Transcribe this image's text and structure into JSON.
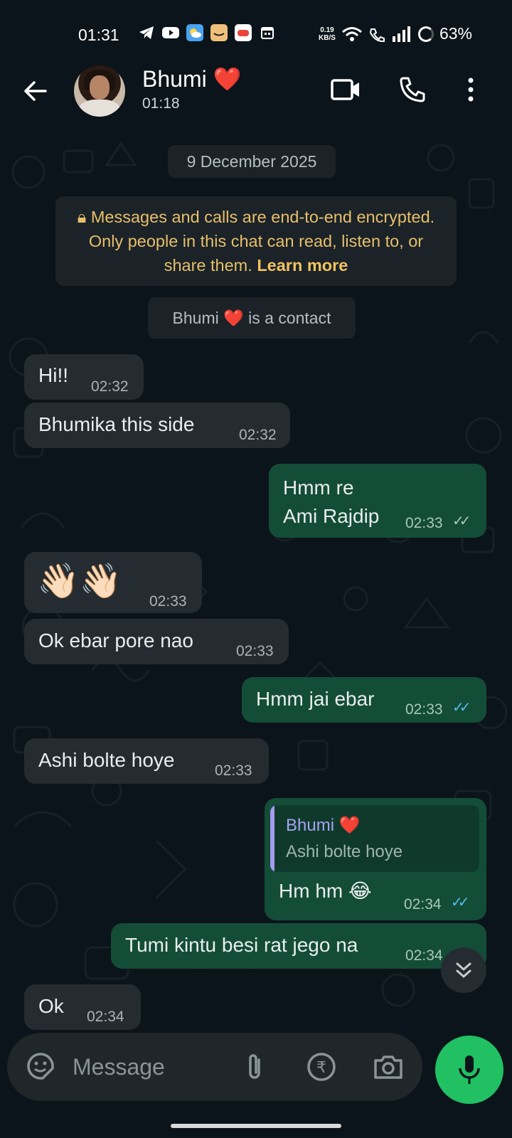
{
  "status_bar": {
    "time": "01:31",
    "speed_value": "0.19",
    "speed_unit": "KB/S",
    "battery": "63%"
  },
  "header": {
    "contact_name": "Bhumi",
    "contact_emoji": "❤️",
    "last_seen": "01:18"
  },
  "chat": {
    "date_pill": "9 December 2025",
    "encryption_text": "Messages and calls are end-to-end encrypted. Only people in this chat can read, listen to, or share them.",
    "encryption_link": "Learn more",
    "contact_notice": "is a contact",
    "messages": [
      {
        "dir": "in",
        "text": "Hi!!",
        "time": "02:32"
      },
      {
        "dir": "in",
        "text": "Bhumika this side",
        "time": "02:32"
      },
      {
        "dir": "out",
        "text": "Hmm re\nAmi Rajdip",
        "time": "02:33",
        "status": "delivered"
      },
      {
        "dir": "in",
        "text": "👋🏻👋🏻",
        "time": "02:33"
      },
      {
        "dir": "in",
        "text": "Ok ebar pore nao",
        "time": "02:33"
      },
      {
        "dir": "out",
        "text": "Hmm jai ebar",
        "time": "02:33",
        "status": "read"
      },
      {
        "dir": "in",
        "text": "Ashi bolte hoye",
        "time": "02:33"
      },
      {
        "dir": "out",
        "text": "Hm hm 😂",
        "time": "02:34",
        "status": "read",
        "quote": {
          "author": "Bhumi",
          "text": "Ashi bolte hoye"
        }
      },
      {
        "dir": "out",
        "text": "Tumi kintu besi rat jego na",
        "time": "02:34",
        "status": "read"
      },
      {
        "dir": "in",
        "text": "Ok",
        "time": "02:34"
      }
    ]
  },
  "composer": {
    "placeholder": "Message",
    "rupee_symbol": "₹"
  },
  "colors": {
    "background": "#0b141a",
    "incoming_bubble": "#242c31",
    "outgoing_bubble": "#144d37",
    "accent_green": "#21c063",
    "read_ticks": "#53bdeb",
    "encryption_text": "#e8bf6a"
  }
}
